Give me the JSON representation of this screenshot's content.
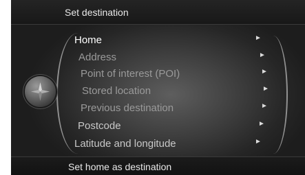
{
  "header": {
    "title": "Set destination"
  },
  "menu": {
    "items": [
      {
        "label": "Home",
        "arrow": "►"
      },
      {
        "label": "Address",
        "arrow": "►"
      },
      {
        "label": "Point of interest (POI)",
        "arrow": "►"
      },
      {
        "label": "Stored location",
        "arrow": "►"
      },
      {
        "label": "Previous destination",
        "arrow": "►"
      },
      {
        "label": "Postcode",
        "arrow": "►"
      },
      {
        "label": "Latitude and longitude",
        "arrow": "►"
      }
    ],
    "selected_index": 0
  },
  "footer": {
    "text": "Set home as destination"
  },
  "icons": {
    "knob": "compass-knob-icon"
  }
}
